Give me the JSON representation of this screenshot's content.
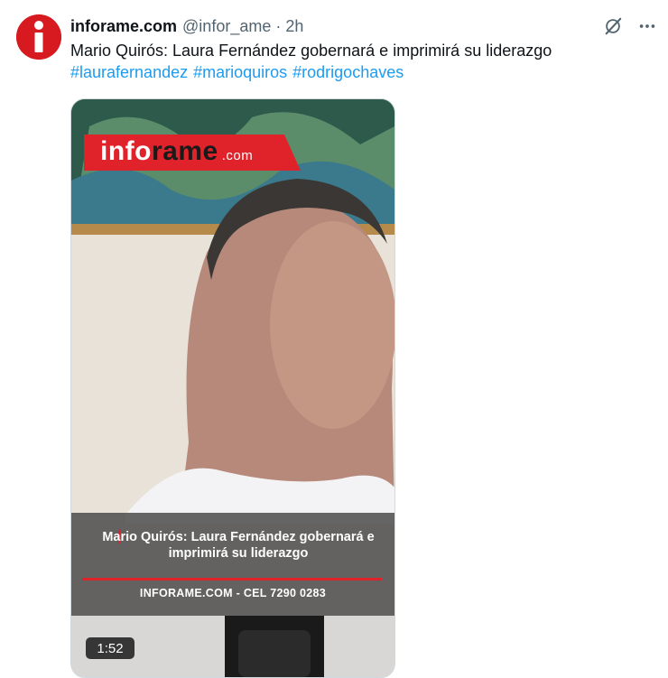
{
  "tweet": {
    "author_name": "inforame.com",
    "handle": "@infor_ame",
    "separator": "·",
    "time": "2h",
    "text": "Mario Quirós: Laura Fernández gobernará e imprimirá su liderazgo",
    "hashtags": [
      "#laurafernandez",
      "#marioquiros",
      "#rodrigochaves"
    ]
  },
  "actions": {
    "grok_icon": "grok-icon",
    "more_icon": "more-icon"
  },
  "video": {
    "banner_brand_a": "info",
    "banner_brand_b": "rame",
    "banner_brand_c": ".com",
    "caption_title": "Mario Quirós: Laura Fernández gobernará e imprimirá su liderazgo",
    "caption_footer": "INFORAME.COM - CEL 7290 0283",
    "duration": "1:52"
  },
  "colors": {
    "brand_red": "#d71920",
    "link_blue": "#1d9bf0",
    "muted": "#536471"
  }
}
